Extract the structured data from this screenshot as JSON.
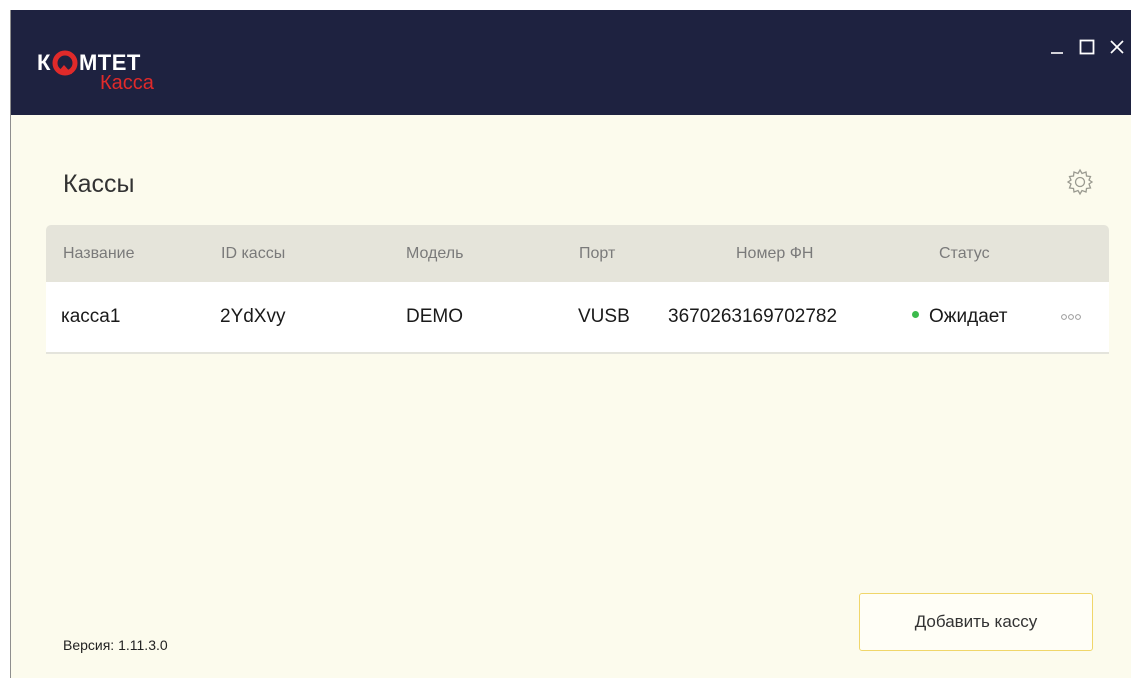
{
  "app": {
    "logo_text_left": "К",
    "logo_text_right": "МТЕТ",
    "logo_sub": "Касса",
    "colors": {
      "titlebar": "#1e2240",
      "background": "#fcfbed",
      "logo_red": "#e02a2a",
      "status_ok": "#3cba4c",
      "accent_border": "#f0d66a"
    }
  },
  "window_controls": {
    "minimize_icon": "minimize-icon",
    "maximize_icon": "maximize-icon",
    "close_icon": "close-icon"
  },
  "page": {
    "title": "Кассы",
    "settings_icon": "gear-icon"
  },
  "table": {
    "headers": [
      "Название",
      "ID кассы",
      "Модель",
      "Порт",
      "Номер ФН",
      "Статус"
    ],
    "rows": [
      {
        "name": "касса1",
        "id": "2YdXvy",
        "model": "DEMO",
        "port": "VUSB",
        "fn_number": "3670263169702782",
        "status": "Ожидает",
        "status_color": "#3cba4c"
      }
    ]
  },
  "footer": {
    "add_button_label": "Добавить кассу",
    "version_text": "Версия: 1.11.3.0"
  }
}
